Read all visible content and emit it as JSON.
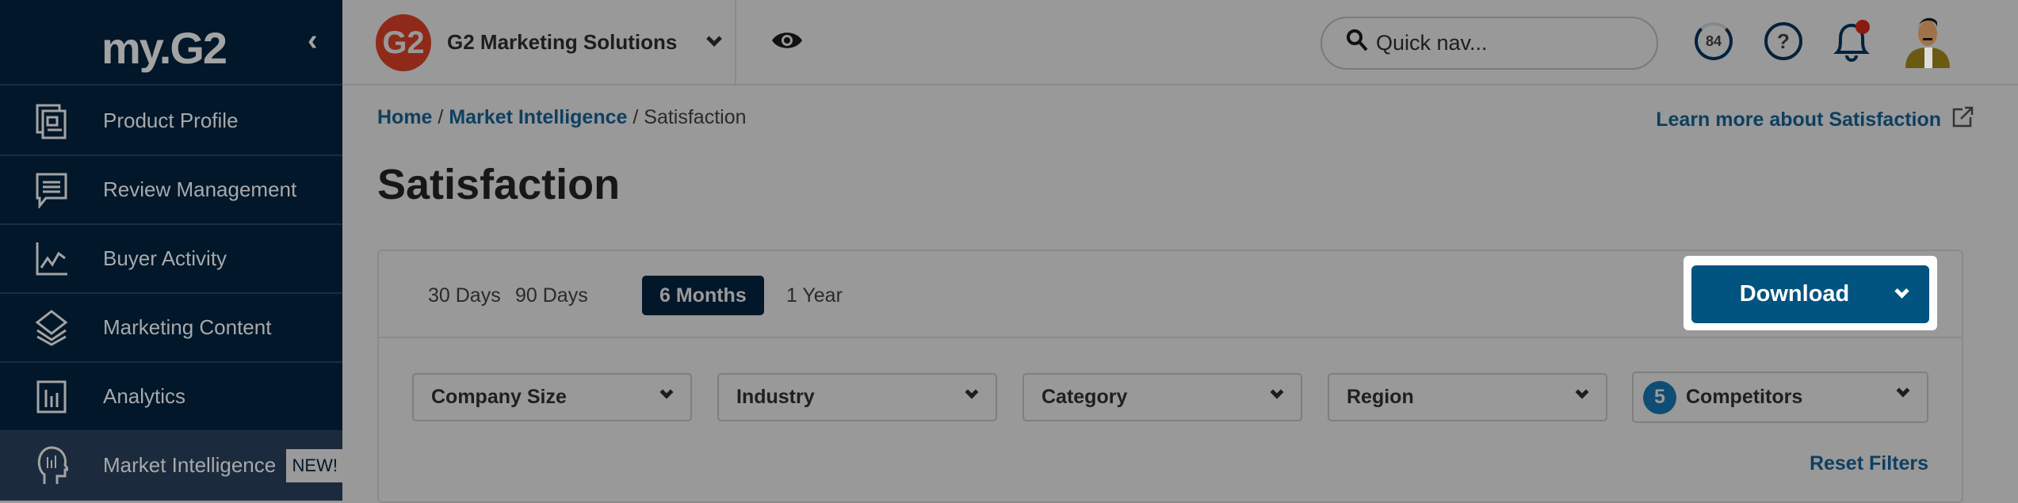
{
  "sidebar": {
    "logo": "my.G2",
    "collapse_icon": "chevron-left-icon",
    "items": [
      {
        "label": "Product Profile",
        "icon": "product-profile-icon"
      },
      {
        "label": "Review Management",
        "icon": "review-chat-icon"
      },
      {
        "label": "Buyer Activity",
        "icon": "chart-line-icon"
      },
      {
        "label": "Marketing Content",
        "icon": "layers-icon"
      },
      {
        "label": "Analytics",
        "icon": "analytics-icon"
      },
      {
        "label": "Market Intelligence",
        "icon": "head-chart-icon",
        "badge": "NEW!",
        "active": true
      }
    ]
  },
  "header": {
    "company": "G2 Marketing Solutions",
    "logo": "G2",
    "search_placeholder": "Quick nav...",
    "score": "84",
    "help": "?"
  },
  "breadcrumb": {
    "home": "Home",
    "section": "Market Intelligence",
    "current": "Satisfaction",
    "sep": "/"
  },
  "learn_more": "Learn more about Satisfaction",
  "page_title": "Satisfaction",
  "tabs": [
    {
      "label": "30 Days"
    },
    {
      "label": "90 Days"
    },
    {
      "label": "6 Months",
      "active": true
    },
    {
      "label": "1 Year"
    }
  ],
  "download_label": "Download",
  "filters": {
    "company_size": "Company Size",
    "industry": "Industry",
    "category": "Category",
    "region": "Region",
    "competitors_count": "5",
    "competitors": "Competitors"
  },
  "reset_filters": "Reset Filters",
  "colors": {
    "sidebar": "#021729",
    "accent": "#015380",
    "notification": "#8b1a10"
  }
}
